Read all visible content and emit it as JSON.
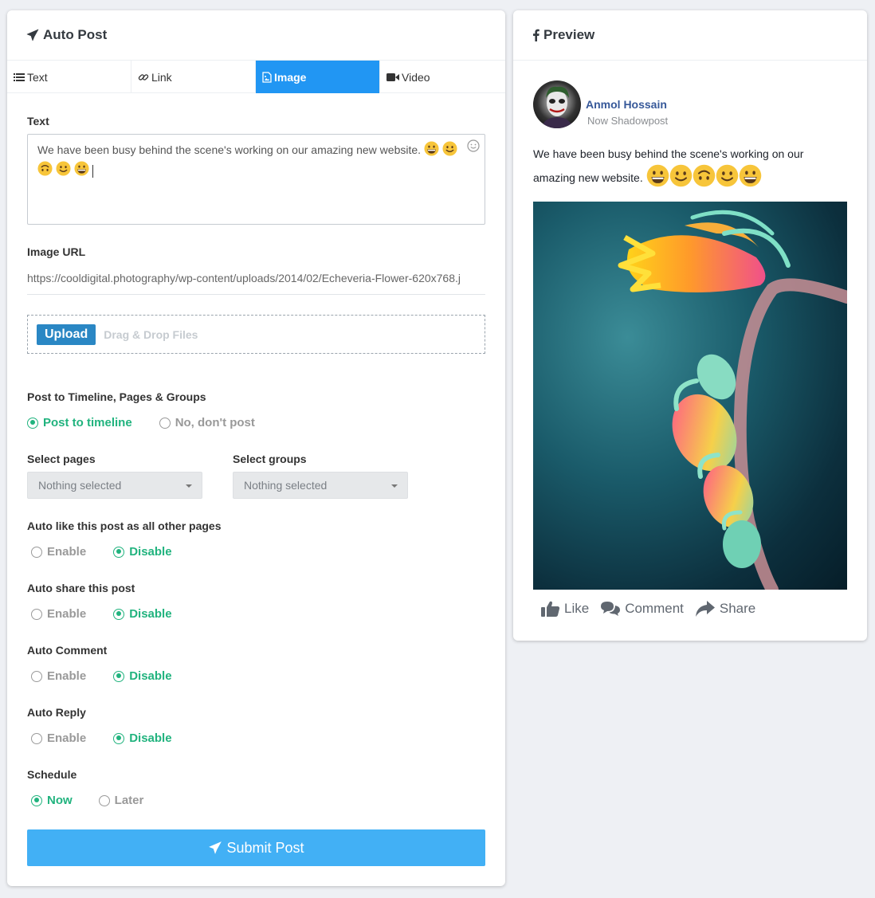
{
  "left_panel": {
    "title": "Auto Post",
    "tabs": [
      {
        "label": "Text",
        "icon": "list-icon",
        "active": false
      },
      {
        "label": "Link",
        "icon": "link-icon",
        "active": false
      },
      {
        "label": "Image",
        "icon": "image-icon",
        "active": true
      },
      {
        "label": "Video",
        "icon": "video-icon",
        "active": false
      }
    ],
    "text_label": "Text",
    "text_value": "We have been busy behind the scene's working on our amazing new website.",
    "text_emojis": [
      "grin",
      "smile",
      "upside-down",
      "smile",
      "grin"
    ],
    "image_url_label": "Image URL",
    "image_url_value": "https://cooldigital.photography/wp-content/uploads/2014/02/Echeveria-Flower-620x768.j",
    "upload_button": "Upload",
    "drop_hint": "Drag & Drop Files",
    "post_to_label": "Post to Timeline, Pages & Groups",
    "post_to_options": [
      "Post to timeline",
      "No, don't post"
    ],
    "select_pages_label": "Select pages",
    "select_pages_value": "Nothing selected",
    "select_groups_label": "Select groups",
    "select_groups_value": "Nothing selected",
    "auto_like_label": "Auto like this post as all other pages",
    "auto_share_label": "Auto share this post",
    "auto_comment_label": "Auto Comment",
    "auto_reply_label": "Auto Reply",
    "enable_label": "Enable",
    "disable_label": "Disable",
    "schedule_label": "Schedule",
    "schedule_options": [
      "Now",
      "Later"
    ],
    "submit_button": "Submit Post"
  },
  "right_panel": {
    "title": "Preview",
    "author_name": "Anmol Hossain",
    "post_meta": "Now Shadowpost",
    "post_text": "We have been busy behind the scene's working on our amazing new website.",
    "actions": [
      "Like",
      "Comment",
      "Share"
    ]
  },
  "colors": {
    "accent": "#2196f3",
    "submit": "#42b0f5",
    "checked": "#21b37e",
    "author": "#365899"
  }
}
